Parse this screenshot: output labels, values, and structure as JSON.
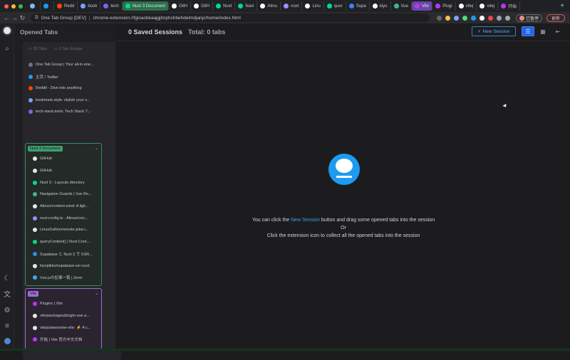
{
  "browser": {
    "tabs": [
      {
        "label": "",
        "color": "#8ab4f8"
      },
      {
        "label": "",
        "color": "#1d9bf0"
      },
      {
        "label": "Redd",
        "color": "#ff4500"
      },
      {
        "label": "book",
        "color": "#7aa2f7"
      },
      {
        "label": "tech",
        "color": "#8b5cf6"
      },
      {
        "label": "Nuxt 3 Document",
        "pill": "nuxt",
        "color": "#00dc82"
      },
      {
        "label": "GitH",
        "color": "#ffffff"
      },
      {
        "label": "GitH",
        "color": "#ffffff"
      },
      {
        "label": "Nuxt",
        "color": "#00dc82"
      },
      {
        "label": "Navi",
        "color": "#00dc82"
      },
      {
        "label": "Atinu",
        "color": "#ffffff"
      },
      {
        "label": "nuxt",
        "color": "#a78bfa"
      },
      {
        "label": "Linu",
        "color": "#ffffff"
      },
      {
        "label": "quer",
        "color": "#00dc82"
      },
      {
        "label": "Supa",
        "color": "#3b82f6"
      },
      {
        "label": "kiyo",
        "color": "#ffffff"
      },
      {
        "label": "Vue",
        "color": "#41b883"
      },
      {
        "label": "Vite",
        "pill": "vite",
        "color": "#bd34fe"
      },
      {
        "label": "Plugi",
        "color": "#bd34fe"
      },
      {
        "label": "vite|",
        "color": "#ffffff"
      },
      {
        "label": "vitej",
        "color": "#ffffff"
      },
      {
        "label": "开始",
        "color": "#bd34fe"
      }
    ],
    "new_tab_glyph": "+",
    "url_prefix": "One Tab Group [DEV]",
    "url_separator": "|",
    "url": "chrome-extension://fgioacbkaajgjlmphchbehdelmdjanjc/home/index.html",
    "pause_label": "已暂停",
    "update_label": "更新"
  },
  "sidebar": {
    "title": "Opened Tabs",
    "tab_count": "26 Tabs",
    "group_count": "2 Tab Groups",
    "ungrouped": [
      {
        "label": "One Tab Group | Your all-in-one...",
        "color": "#6b7280"
      },
      {
        "label": "主页 / Twitter",
        "color": "#1d9bf0"
      },
      {
        "label": "Reddit - Dive into anything",
        "color": "#ff4500"
      },
      {
        "label": "bookmark.style: stylish your v...",
        "color": "#7aa2f7"
      },
      {
        "label": "tech-stack.tools: Tech Stack T...",
        "color": "#8b5cf6"
      }
    ],
    "groups": [
      {
        "name": "Nuxt 3 Document",
        "items": [
          {
            "label": "GitHub",
            "color": "#e5e7eb"
          },
          {
            "label": "GitHub",
            "color": "#e5e7eb"
          },
          {
            "label": "Nuxt 3 - Layouts directory",
            "color": "#00dc82"
          },
          {
            "label": "Navigation Guards | Vue Ro...",
            "color": "#41b883"
          },
          {
            "label": "Atinux/content-wind: A ligh...",
            "color": "#e5e7eb"
          },
          {
            "label": "nuxt.config.ts - Atinux/con...",
            "color": "#a78bfa"
          },
          {
            "label": "LinusSuRen/remote-jobs-i...",
            "color": "#e5e7eb"
          },
          {
            "label": "queryContent() | Nuxt Cont...",
            "color": "#00dc82"
          },
          {
            "label": "Supabase と Nuxt 3 で SSR...",
            "color": "#3b82f6"
          },
          {
            "label": "kiyopikko/supabase-ssr-nuxt",
            "color": "#e5e7eb"
          },
          {
            "label": "Vue.jsの記事一覧 | Zenn",
            "color": "#3ea8ff"
          }
        ]
      },
      {
        "name": "Vite",
        "items": [
          {
            "label": "Plugins | Vite",
            "color": "#bd34fe"
          },
          {
            "label": "vite/packages/plugin-vue a...",
            "color": "#e5e7eb"
          },
          {
            "label": "vitejs/awesome-vite: ⚡ A c...",
            "color": "#e5e7eb"
          },
          {
            "label": "开始 | Vite 官方中文文档",
            "color": "#bd34fe"
          }
        ]
      }
    ]
  },
  "main": {
    "title": "0 Saved Sessions",
    "subtitle": "Total: 0 tabs",
    "new_session_label": "New Session",
    "empty": {
      "line1_before": "You can click the ",
      "line1_link": "New Session",
      "line1_after": " button and drag some opened tabs into the session",
      "line2": "Or",
      "line3": "Click the extension icon to collect all the opened tabs into the session"
    }
  }
}
